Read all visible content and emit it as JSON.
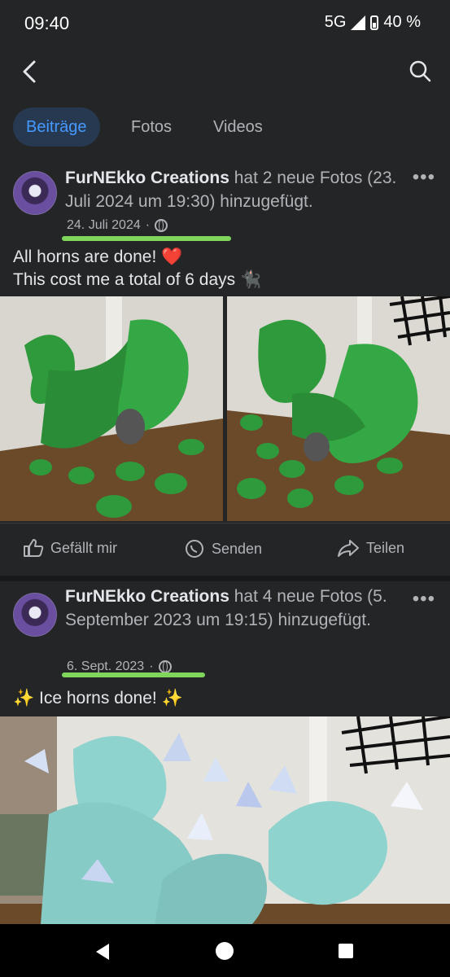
{
  "status": {
    "time": "09:40",
    "network": "5G",
    "battery": "40 %"
  },
  "tabs": [
    {
      "label": "Beiträge",
      "active": true
    },
    {
      "label": "Fotos",
      "active": false
    },
    {
      "label": "Videos",
      "active": false
    }
  ],
  "posts": [
    {
      "author": "FurNEkko Creations",
      "headline_rest": " hat 2 neue Fotos (23. Juli 2024 um 19:30) hinzugefügt.",
      "date": "24. Juli 2024",
      "text_line1": "All horns are done! ❤️",
      "text_line2": "This cost me a total of 6 days 🐈‍⬛",
      "photos": [
        "green plush dragon horns on wooden floor",
        "green plush dragon horns, second angle"
      ]
    },
    {
      "author": "FurNEkko Creations",
      "headline_rest": " hat 4 neue Fotos (5. September 2023 um 19:15) hinzugefügt.",
      "date": "6. Sept. 2023",
      "text_line1": "✨ Ice horns done! ✨",
      "photos": [
        "icy teal plush horns with crystal spikes"
      ]
    }
  ],
  "actions": {
    "like": "Gefällt mir",
    "send": "Senden",
    "share": "Teilen"
  },
  "colors": {
    "accent": "#4599ff",
    "highlight": "#7fd65a",
    "plush_green": "#2e9a3c",
    "plush_ice": "#8fd3cf"
  }
}
